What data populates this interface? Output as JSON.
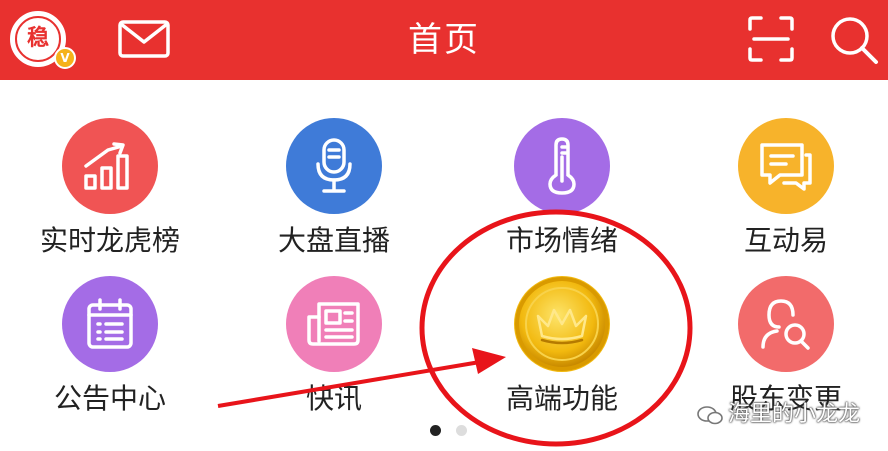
{
  "header": {
    "title": "首页",
    "avatar_text": "稳",
    "vip_badge": "V",
    "bg_color": "#e8312f"
  },
  "grid": {
    "items": [
      {
        "label": "实时龙虎榜",
        "icon": "bar-chart-up-icon",
        "color": "#f05454"
      },
      {
        "label": "大盘直播",
        "icon": "microphone-icon",
        "color": "#3f7bd8"
      },
      {
        "label": "市场情绪",
        "icon": "thermometer-icon",
        "color": "#a46ce6"
      },
      {
        "label": "互动易",
        "icon": "chat-bubble-icon",
        "color": "#f7b32b"
      },
      {
        "label": "公告中心",
        "icon": "calendar-list-icon",
        "color": "#a46ce6"
      },
      {
        "label": "快讯",
        "icon": "newspaper-icon",
        "color": "#f07fb8"
      },
      {
        "label": "高端功能",
        "icon": "gold-crown-coin-icon",
        "color": "#f2b90f"
      },
      {
        "label": "股东变更",
        "icon": "user-search-icon",
        "color": "#f26b6b"
      }
    ]
  },
  "pager": {
    "active": 1,
    "total": 2
  },
  "watermark": {
    "text": "海里的小龙龙"
  }
}
